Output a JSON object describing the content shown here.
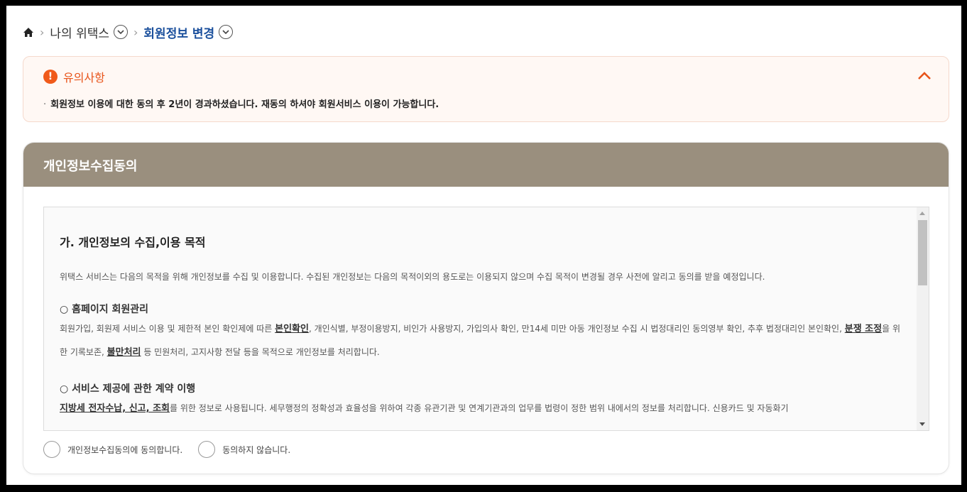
{
  "breadcrumb": {
    "home_icon": "home-icon",
    "items": [
      {
        "label": "나의 위택스"
      },
      {
        "label": "회원정보 변경"
      }
    ]
  },
  "notice": {
    "title": "유의사항",
    "message": "회원정보 이용에 대한 동의 후 2년이 경과하셨습니다. 재동의 하셔야 회원서비스 이용이 가능합니다.",
    "accent_color": "#e8541a"
  },
  "consent": {
    "header": "개인정보수집동의",
    "header_color": "#9a8f7e",
    "section_title": "가. 개인정보의 수집,이용 목적",
    "intro": "위택스 서비스는 다음의 목적을 위해 개인정보를 수집 및 이용합니다. 수집된 개인정보는 다음의 목적이외의 용도로는 이용되지 않으며 수집 목적이 변경될 경우 사전에 알리고 동의를 받을 예정입니다.",
    "item1": {
      "title": "○ 홈페이지 회원관리",
      "text_a": "회원가입, 회원제 서비스 이용 및 제한적 본인 확인제에 따른 ",
      "em_a": "본인확인",
      "text_b": ", 개인식별, 부정이용방지, 비인가 사용방지, 가입의사 확인, 만14세 미만 아동 개인정보 수집 시 법정대리인 동의영부 확인, 추후 법정대리인 본인확인, ",
      "em_b": "분쟁 조정",
      "text_c": "을 위한 기록보존, ",
      "em_c": "불만처리",
      "text_d": " 등 민원처리, 고지사항 전달 등을 목적으로 개인정보를 처리합니다."
    },
    "item2": {
      "title": "○ 서비스 제공에 관한 계약 이행",
      "em_a": "지방세 전자수납, 신고, 조회",
      "text_a": "를 위한 정보로 사용됩니다. 세무행정의 정확성과 효율성을 위하여 각종 유관기관 및 연계기관과의 업무를 법령이 정한 범위 내에서의 정보를 처리합니다. 신용카드 및 자동화기"
    },
    "agree_label": "개인정보수집동의에 동의합니다.",
    "disagree_label": "동의하지 않습니다."
  }
}
